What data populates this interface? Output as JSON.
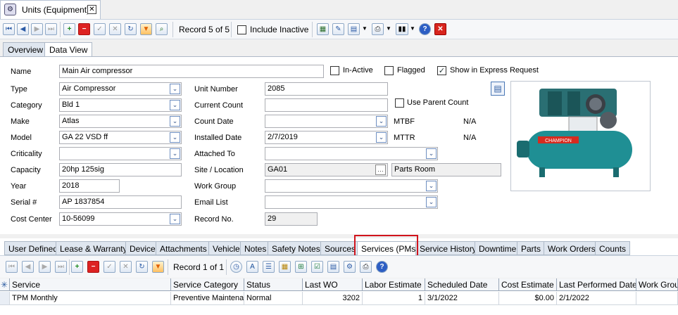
{
  "window": {
    "tab_title": "Units (Equipment)",
    "close_icon": "close-icon"
  },
  "toolbar": {
    "record_text": "Record 5 of 5",
    "include_inactive": "Include Inactive",
    "include_inactive_checked": false
  },
  "view_tabs": [
    "Overview",
    "Data View"
  ],
  "view_tab_active": "Data View",
  "form": {
    "name_label": "Name",
    "name_value": "Main Air  compressor",
    "inactive_label": "In-Active",
    "inactive_checked": false,
    "flagged_label": "Flagged",
    "flagged_checked": false,
    "express_label": "Show in Express Request",
    "express_checked": true,
    "type_label": "Type",
    "type_value": "Air Compressor",
    "category_label": "Category",
    "category_value": "Bld 1",
    "make_label": "Make",
    "make_value": "Atlas",
    "model_label": "Model",
    "model_value": "GA 22 VSD ff",
    "criticality_label": "Criticality",
    "criticality_value": "",
    "capacity_label": "Capacity",
    "capacity_value": "20hp 125sig",
    "year_label": "Year",
    "year_value": "2018",
    "serial_label": "Serial #",
    "serial_value": "AP 1837854",
    "costcenter_label": "Cost Center",
    "costcenter_value": "10-56099",
    "unitnumber_label": "Unit Number",
    "unitnumber_value": "2085",
    "currentcount_label": "Current Count",
    "currentcount_value": "",
    "useparent_label": "Use Parent Count",
    "useparent_checked": false,
    "countdate_label": "Count Date",
    "countdate_value": "",
    "installed_label": "Installed Date",
    "installed_value": "2/7/2019",
    "mtbf_label": "MTBF",
    "mtbf_value": "N/A",
    "mttr_label": "MTTR",
    "mttr_value": "N/A",
    "attached_label": "Attached To",
    "attached_value": "",
    "site_label": "Site / Location",
    "site_value": "GA01",
    "location_value": "Parts Room",
    "workgroup_label": "Work Group",
    "workgroup_value": "",
    "email_label": "Email List",
    "email_value": "",
    "recordno_label": "Record No.",
    "recordno_value": "29",
    "picture_brand": "CHAMPION"
  },
  "sub_tabs": [
    "User Defined",
    "Lease & Warranty",
    "Device",
    "Attachments",
    "Vehicle",
    "Notes",
    "Safety Notes",
    "Sources",
    "Services (PMs)",
    "Service History",
    "Downtime",
    "Parts",
    "Work Orders",
    "Counts"
  ],
  "sub_tab_active": "Services (PMs)",
  "sub_toolbar": {
    "record_text": "Record 1 of 1"
  },
  "grid": {
    "columns": [
      "Service",
      "Service Category",
      "Status",
      "Last WO",
      "Labor Estimate",
      "Scheduled Date",
      "Cost Estimate",
      "Last Performed Date",
      "Work Group"
    ],
    "rows": [
      [
        "TPM Monthly",
        "Preventive Maintenance",
        "Normal",
        "3202",
        "1",
        "3/1/2022",
        "$0.00",
        "2/1/2022",
        ""
      ]
    ]
  },
  "colors": {
    "accent_highlight": "#d1141c",
    "tab_bg": "#dfe6ef",
    "compressor_teal": "#1f8f94"
  }
}
